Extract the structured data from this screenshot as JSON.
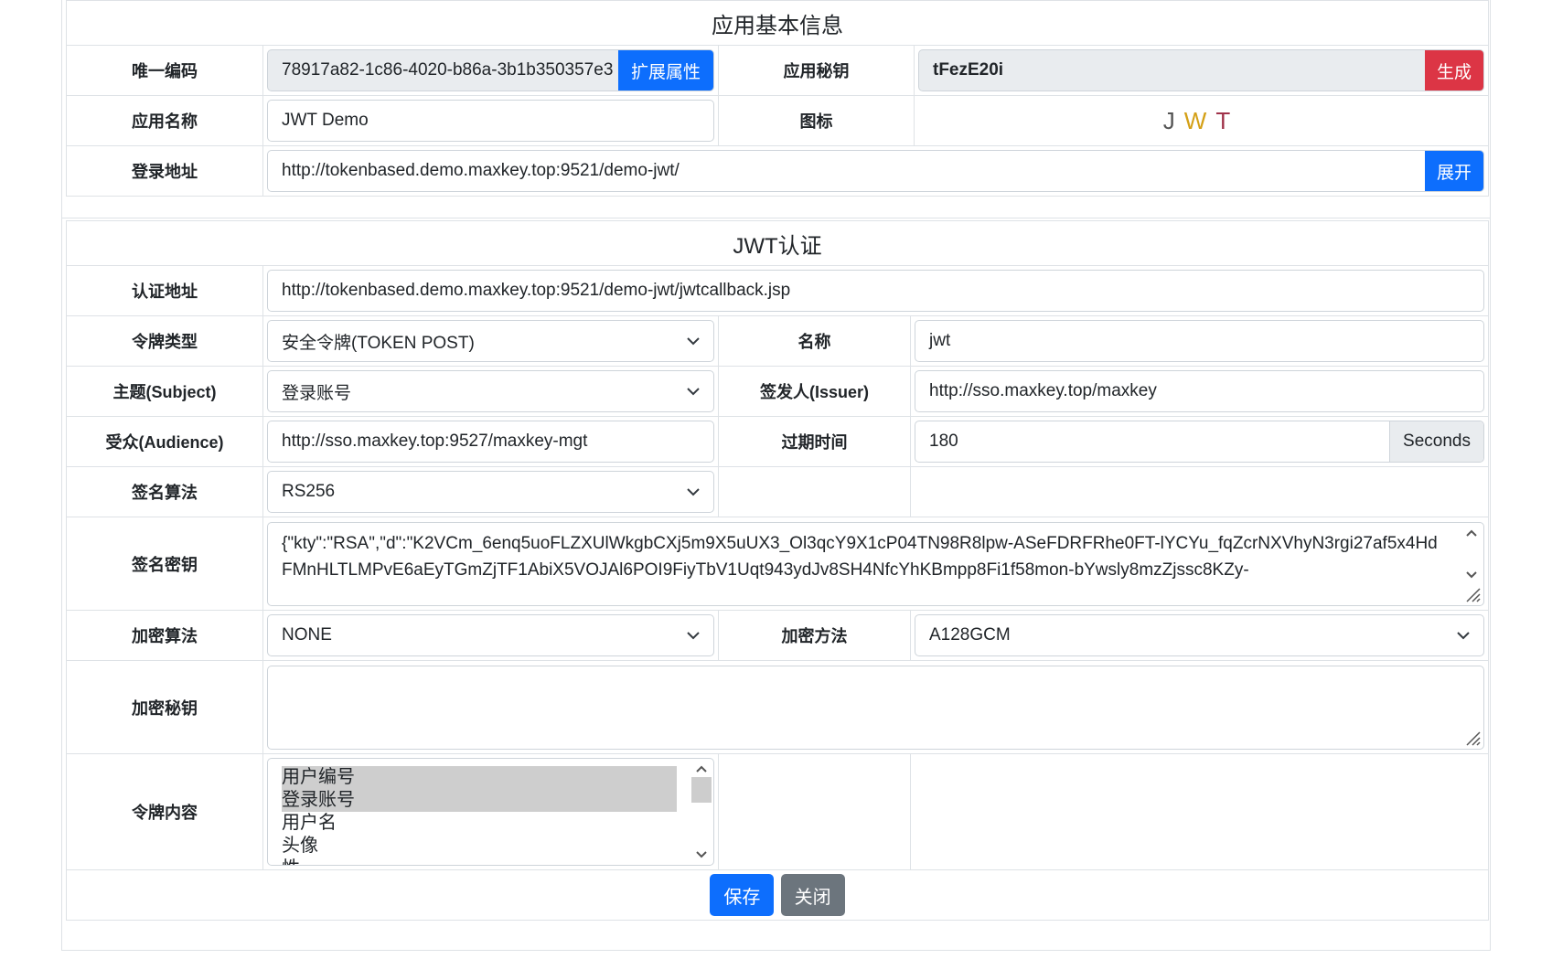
{
  "basic": {
    "title": "应用基本信息",
    "unique_code_label": "唯一编码",
    "unique_code_value": "78917a82-1c86-4020-b86a-3b1b350357e3",
    "extend_button": "扩展属性",
    "secret_label": "应用秘钥",
    "secret_value": "tFezE20i",
    "generate_button": "生成",
    "name_label": "应用名称",
    "name_value": "JWT Demo",
    "icon_label": "图标",
    "icon_letters": [
      "J",
      "W",
      "T"
    ],
    "icon_colors": [
      "#555555",
      "#d4a017",
      "#a0324a"
    ],
    "login_label": "登录地址",
    "login_value": "http://tokenbased.demo.maxkey.top:9521/demo-jwt/",
    "expand_button": "展开"
  },
  "jwt": {
    "title": "JWT认证",
    "auth_url_label": "认证地址",
    "auth_url_value": "http://tokenbased.demo.maxkey.top:9521/demo-jwt/jwtcallback.jsp",
    "token_type_label": "令牌类型",
    "token_type_value": "安全令牌(TOKEN POST)",
    "token_name_label": "名称",
    "token_name_value": "jwt",
    "subject_label": "主题(Subject)",
    "subject_value": "登录账号",
    "issuer_label": "签发人(Issuer)",
    "issuer_value": "http://sso.maxkey.top/maxkey",
    "audience_label": "受众(Audience)",
    "audience_value": "http://sso.maxkey.top:9527/maxkey-mgt",
    "expires_label": "过期时间",
    "expires_value": "180",
    "expires_unit": "Seconds",
    "sign_alg_label": "签名算法",
    "sign_alg_value": "RS256",
    "sign_key_label": "签名密钥",
    "sign_key_value": "{\"kty\":\"RSA\",\"d\":\"K2VCm_6enq5uoFLZXUlWkgbCXj5m9X5uUX3_Ol3qcY9X1cP04TN98R8lpw-ASeFDRFRhe0FT-lYCYu_fqZcrNXVhyN3rgi27af5x4HdFMnHLTLMPvE6aEyTGmZjTF1AbiX5VOJAl6POI9FiyTbV1Uqt943ydJv8SH4NfcYhKBmpp8Fi1f58mon-bYwsly8mzZjssc8KZy-",
    "enc_alg_label": "加密算法",
    "enc_alg_value": "NONE",
    "enc_method_label": "加密方法",
    "enc_method_value": "A128GCM",
    "enc_key_label": "加密秘钥",
    "enc_key_value": "",
    "claims_label": "令牌内容",
    "claims_items": [
      "用户编号",
      "登录账号",
      "用户名",
      "头像",
      "性"
    ]
  },
  "actions": {
    "save": "保存",
    "close": "关闭"
  }
}
